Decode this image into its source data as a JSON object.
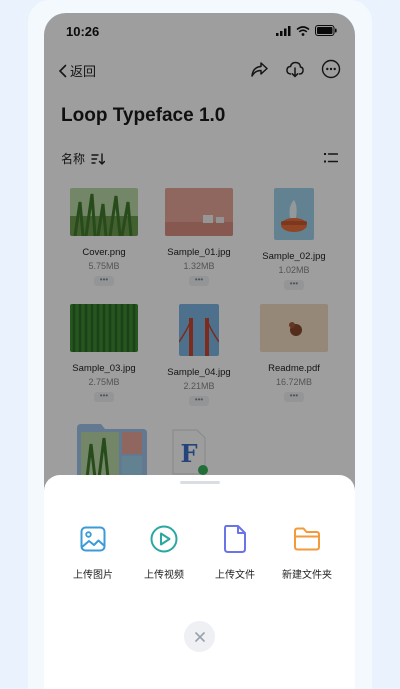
{
  "status_bar": {
    "time": "10:26"
  },
  "nav": {
    "back_label": "返回"
  },
  "page": {
    "title": "Loop Typeface 1.0",
    "sort_label": "名称"
  },
  "files": [
    {
      "name": "Cover.png",
      "size": "5.75MB",
      "icon": "grass-photo"
    },
    {
      "name": "Sample_01.jpg",
      "size": "1.32MB",
      "icon": "pink-scene-photo"
    },
    {
      "name": "Sample_02.jpg",
      "size": "1.02MB",
      "icon": "pot-photo"
    },
    {
      "name": "Sample_03.jpg",
      "size": "2.75MB",
      "icon": "green-field-photo"
    },
    {
      "name": "Sample_04.jpg",
      "size": "2.21MB",
      "icon": "bridge-photo"
    },
    {
      "name": "Readme.pdf",
      "size": "16.72MB",
      "icon": "pdf-preview"
    }
  ],
  "file_more_label": "•••",
  "bottom_sheet": {
    "actions": [
      {
        "label": "上传图片",
        "icon": "image-icon",
        "color": "#3a9bd9"
      },
      {
        "label": "上传视频",
        "icon": "play-icon",
        "color": "#2aa7a0"
      },
      {
        "label": "上传文件",
        "icon": "file-icon",
        "color": "#6a74e6"
      },
      {
        "label": "新建文件夹",
        "icon": "folder-icon",
        "color": "#f39a3c"
      }
    ]
  }
}
